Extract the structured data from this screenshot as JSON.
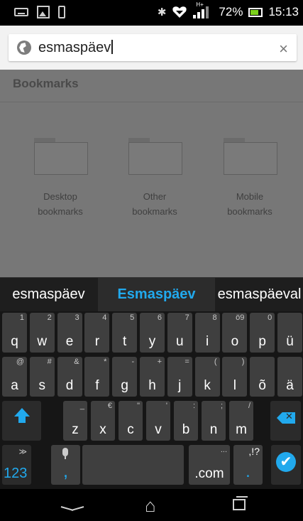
{
  "status_bar": {
    "battery_percent": "72%",
    "time": "15:13",
    "network_label": "H+",
    "icons": [
      "keyboard-icon",
      "picture-icon",
      "phone-icon",
      "bluetooth-icon",
      "heart-icon",
      "signal-icon",
      "battery-icon"
    ]
  },
  "url_bar": {
    "value": "esmaspäev",
    "clear_label": "×"
  },
  "bookmarks": {
    "title": "Bookmarks",
    "folders": [
      {
        "line1": "Desktop",
        "line2": "bookmarks"
      },
      {
        "line1": "Other",
        "line2": "bookmarks"
      },
      {
        "line1": "Mobile",
        "line2": "bookmarks"
      }
    ]
  },
  "suggestions": [
    "esmaspäev",
    "Esmaspäev",
    "esmaspäeval"
  ],
  "keyboard": {
    "row1": [
      {
        "main": "q",
        "alt": "1"
      },
      {
        "main": "w",
        "alt": "2"
      },
      {
        "main": "e",
        "alt": "3"
      },
      {
        "main": "r",
        "alt": "4"
      },
      {
        "main": "t",
        "alt": "5"
      },
      {
        "main": "y",
        "alt": "6"
      },
      {
        "main": "u",
        "alt": "7"
      },
      {
        "main": "i",
        "alt": "8"
      },
      {
        "main": "o",
        "alt": "ö9"
      },
      {
        "main": "p",
        "alt": "0"
      },
      {
        "main": "ü",
        "alt": ""
      }
    ],
    "row2": [
      {
        "main": "a",
        "alt": "@"
      },
      {
        "main": "s",
        "alt": "#"
      },
      {
        "main": "d",
        "alt": "&"
      },
      {
        "main": "f",
        "alt": "*"
      },
      {
        "main": "g",
        "alt": "-"
      },
      {
        "main": "h",
        "alt": "+"
      },
      {
        "main": "j",
        "alt": "="
      },
      {
        "main": "k",
        "alt": "("
      },
      {
        "main": "l",
        "alt": ")"
      },
      {
        "main": "õ",
        "alt": ""
      },
      {
        "main": "ä",
        "alt": ""
      }
    ],
    "row3": [
      {
        "main": "z",
        "alt": "_"
      },
      {
        "main": "x",
        "alt": "€"
      },
      {
        "main": "c",
        "alt": "\""
      },
      {
        "main": "v",
        "alt": "'"
      },
      {
        "main": "b",
        "alt": ":"
      },
      {
        "main": "n",
        "alt": ";"
      },
      {
        "main": "m",
        "alt": "/"
      }
    ],
    "numbers_label": "123",
    "comma_label": ",",
    "dotcom_label": ".com",
    "dotcom_alt": "...",
    "period_label": ".",
    "period_alt": ",!?",
    "enter_label": "✔",
    "home_glyph": "⌂"
  },
  "colors": {
    "accent": "#21a9ed",
    "key_bg": "#3f3f3f",
    "dim_overlay": "#777777"
  }
}
